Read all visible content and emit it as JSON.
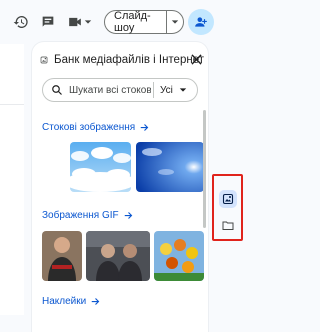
{
  "toolbar": {
    "history_icon": "history-icon",
    "comment_icon": "comment-icon",
    "video_icon": "video-icon",
    "slideshow_label": "Слайд-шоу",
    "share_icon": "person-add-icon"
  },
  "panel": {
    "title": "Банк медіафайлів і Інтернет",
    "search_placeholder": "Шукати всі стокові ме...",
    "filter_label": "Усі",
    "sections": [
      {
        "label": "Стокові зображення"
      },
      {
        "label": "Зображення GIF"
      },
      {
        "label": "Наклейки"
      }
    ]
  },
  "rail": {
    "items": [
      {
        "icon": "media-library-icon",
        "active": true
      },
      {
        "icon": "folder-icon",
        "active": false
      }
    ]
  },
  "colors": {
    "accent": "#0b57d0",
    "share_bg": "#c2e7ff",
    "highlight_border": "#e0231c"
  }
}
